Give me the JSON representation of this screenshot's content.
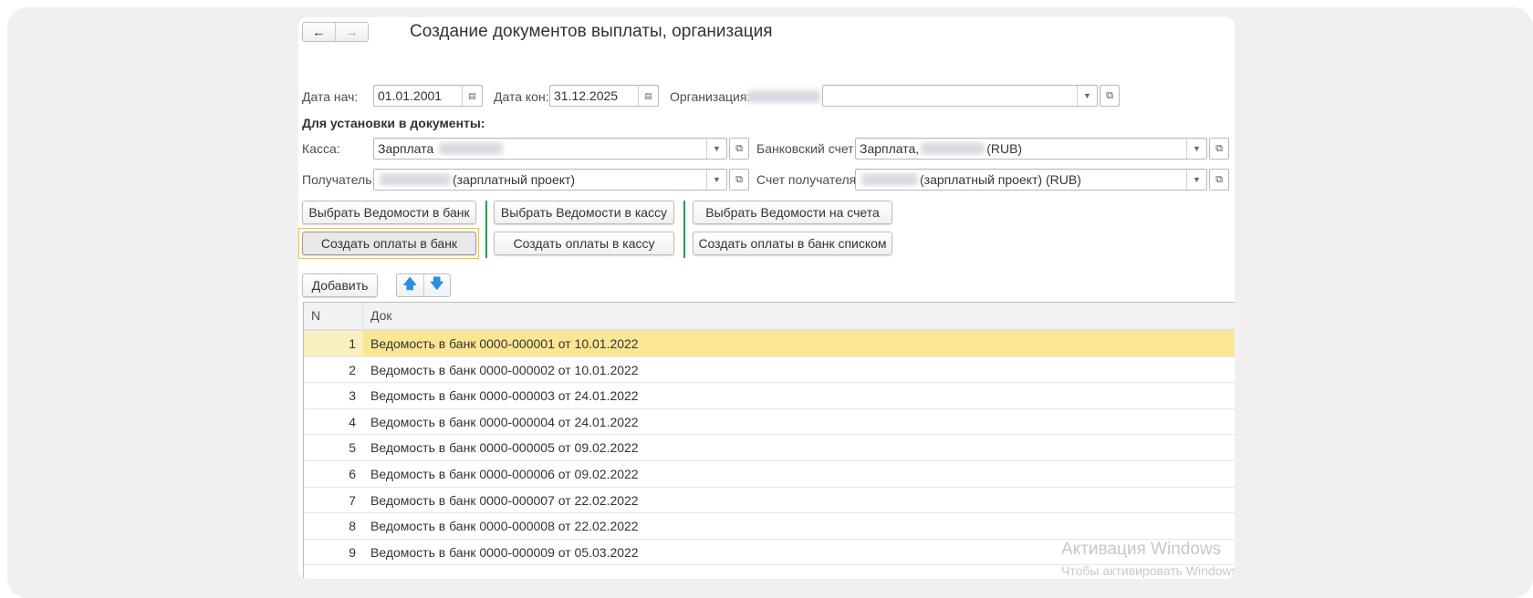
{
  "window": {
    "title": "Создание документов выплаты, организация"
  },
  "nav": {
    "back_icon": "arrow-left",
    "forward_icon": "arrow-right"
  },
  "filters": {
    "date_start_label": "Дата нач:",
    "date_start_value": "01.01.2001",
    "date_end_label": "Дата кон:",
    "date_end_value": "31.12.2025",
    "organization_label": "Организация:",
    "organization_value": ""
  },
  "settings": {
    "section_label": "Для установки в документы:",
    "cash_label": "Касса:",
    "cash_value": "Зарплата",
    "bank_account_label": "Банковский счет:",
    "bank_account_value_prefix": "Зарплата,",
    "bank_account_value_suffix": "(RUB)",
    "recipient_label": "Получатель:",
    "recipient_value_suffix": "(зарплатный проект)",
    "recipient_account_label": "Счет получателя:",
    "recipient_account_value_suffix": "(зарплатный проект) (RUB)"
  },
  "actions": {
    "select_bank": "Выбрать Ведомости в банк",
    "select_cash": "Выбрать Ведомости в кассу",
    "select_accounts": "Выбрать Ведомости на счета",
    "create_bank": "Создать оплаты в банк",
    "create_cash": "Создать оплаты в кассу",
    "create_bank_list": "Создать оплаты в банк списком"
  },
  "toolbar": {
    "add_label": "Добавить",
    "move_up_icon": "arrow-up",
    "move_down_icon": "arrow-down"
  },
  "table": {
    "columns": [
      "N",
      "Док"
    ],
    "selected_row": 0,
    "rows": [
      {
        "n": "1",
        "doc": "Ведомость в банк 0000-000001 от 10.01.2022"
      },
      {
        "n": "2",
        "doc": "Ведомость в банк 0000-000002 от 10.01.2022"
      },
      {
        "n": "3",
        "doc": "Ведомость в банк 0000-000003 от 24.01.2022"
      },
      {
        "n": "4",
        "doc": "Ведомость в банк 0000-000004 от 24.01.2022"
      },
      {
        "n": "5",
        "doc": "Ведомость в банк 0000-000005 от 09.02.2022"
      },
      {
        "n": "6",
        "doc": "Ведомость в банк 0000-000006 от 09.02.2022"
      },
      {
        "n": "7",
        "doc": "Ведомость в банк 0000-000007 от 22.02.2022"
      },
      {
        "n": "8",
        "doc": "Ведомость в банк 0000-000008 от 22.02.2022"
      },
      {
        "n": "9",
        "doc": "Ведомость в банк 0000-000009 от 05.03.2022"
      }
    ]
  },
  "watermark": {
    "line1": "Активация Windows",
    "line2": "Чтобы активировать Windows"
  },
  "colors": {
    "selected_row": "#fbe694",
    "separator": "#1ea14a",
    "focus": "#f5c518"
  }
}
